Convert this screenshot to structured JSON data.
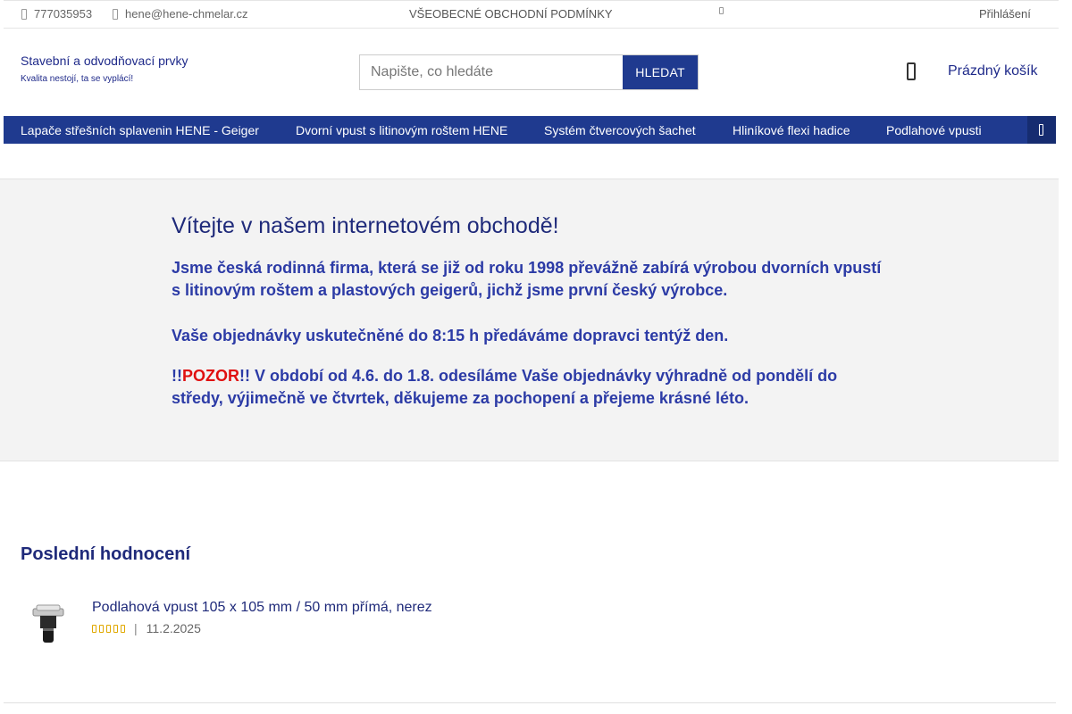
{
  "topbar": {
    "phone": "777035953",
    "email": "hene@hene-chmelar.cz",
    "terms_link": "VŠEOBECNÉ OBCHODNÍ PODMÍNKY",
    "login": "Přihlášení"
  },
  "header": {
    "brand_name": "Stavební a odvodňovací prvky",
    "brand_tagline": "Kvalita nestojí, ta se vyplácí!",
    "search_placeholder": "Napište, co hledáte",
    "search_button": "HLEDAT",
    "cart_label": "Prázdný košík"
  },
  "nav": {
    "items": [
      "Lapače střešních splavenin HENE - Geiger",
      "Dvorní vpust s litinovým roštem HENE",
      "Systém čtvercových šachet",
      "Hliníkové flexi hadice",
      "Podlahové vpusti"
    ]
  },
  "welcome": {
    "title": "Vítejte v našem internetovém obchodě!",
    "p1": "Jsme česká rodinná firma, která se již od roku 1998 převážně zabírá výrobou dvorních vpustí s litinovým roštem a plastových geigerů, jichž jsme první český výrobce.",
    "p2": "Vaše objednávky uskutečněné do 8:15 h předáváme dopravci tentýž den.",
    "p3_prefix": "!!",
    "p3_warn": "POZOR",
    "p3_rest": "!! V období od 4.6. do 1.8. odesíláme Vaše objednávky výhradně od pondělí do středy, výjimečně ve čtvrtek, děkujeme za pochopení a přejeme krásné léto."
  },
  "ratings": {
    "title": "Poslední hodnocení",
    "items": [
      {
        "product": "Podlahová vpust 105 x 105 mm / 50 mm přímá, nerez",
        "separator": "|",
        "date": "11.2.2025",
        "stars": 5
      }
    ]
  },
  "colors": {
    "brand_blue": "#1f3a8f",
    "text_blue": "#2c3ba6",
    "warning_red": "#e01010",
    "star": "#e0a800"
  }
}
